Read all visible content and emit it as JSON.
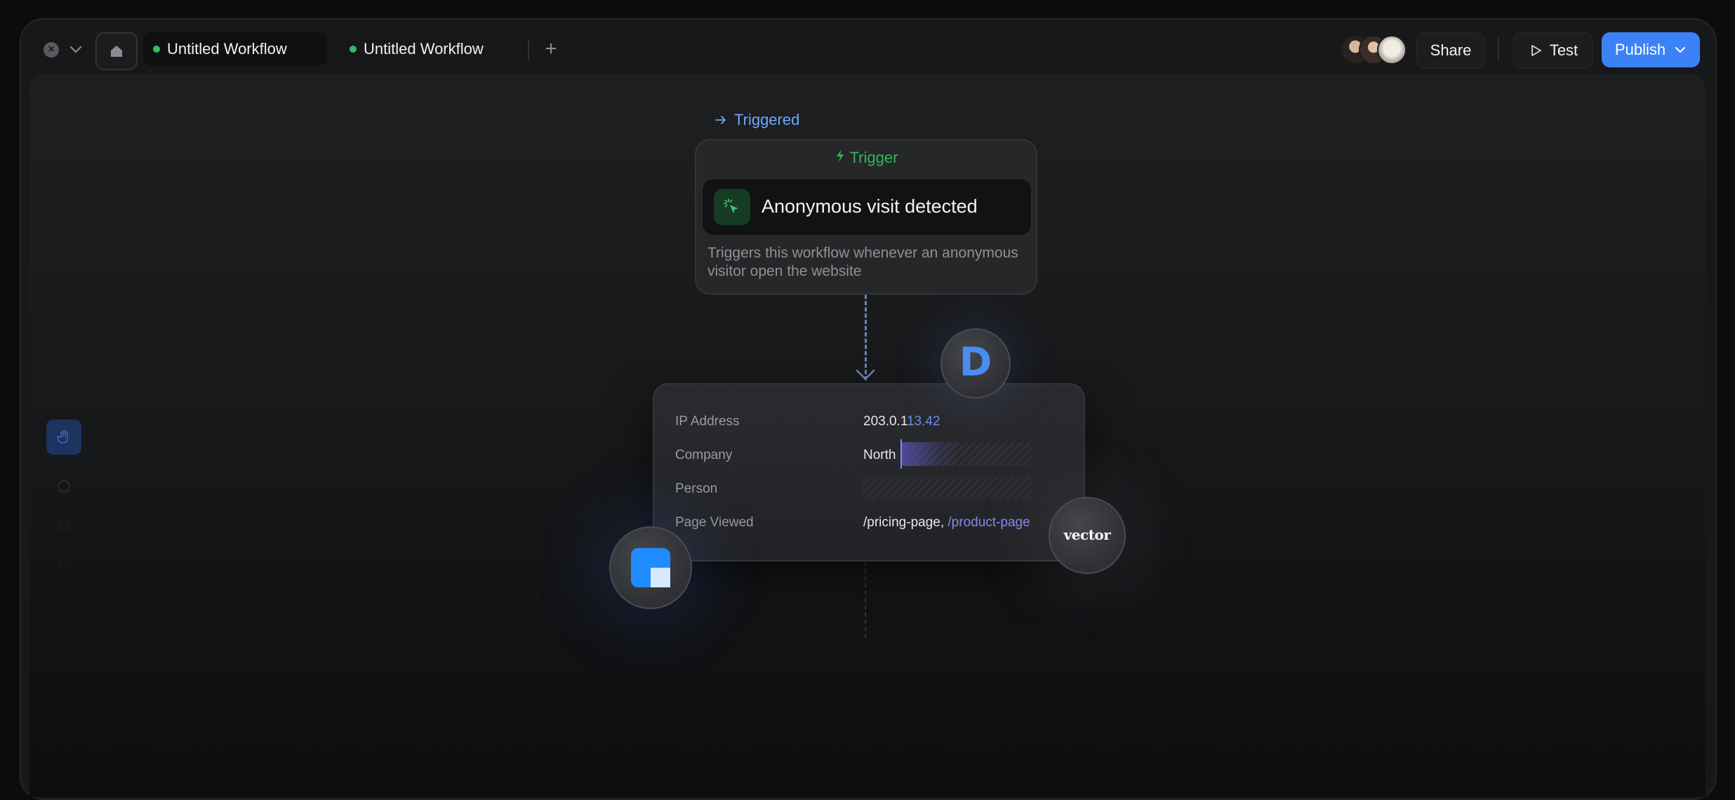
{
  "tabs": [
    {
      "label": "Untitled Workflow",
      "status_color": "#2fbf5f"
    },
    {
      "label": "Untitled Workflow",
      "status_color": "#2fbf5f"
    }
  ],
  "toolbar": {
    "share_label": "Share",
    "test_label": "Test",
    "publish_label": "Publish",
    "publish_color": "#3b82f6"
  },
  "workflow": {
    "triggered_label": "Triggered",
    "trigger": {
      "header": "Trigger",
      "title": "Anonymous visit detected",
      "description": "Triggers this workflow whenever an anonymous visitor open the website"
    },
    "visitor_data": {
      "ip_label": "IP Address",
      "ip_value_plain": "203.0.1",
      "ip_value_hl": "13.42",
      "company_label": "Company",
      "company_value": "North",
      "person_label": "Person",
      "page_label": "Page Viewed",
      "page_value_plain": "/pricing-page, ",
      "page_value_hl": "/product-page"
    },
    "integrations": {
      "d_glyph": "D",
      "vector_glyph": "vector"
    }
  }
}
